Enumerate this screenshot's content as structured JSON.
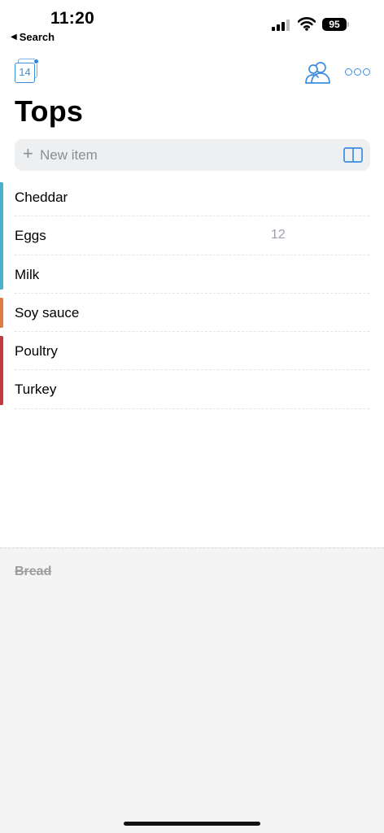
{
  "status_bar": {
    "time": "11:20",
    "back_label": "Search",
    "battery": "95"
  },
  "toolbar": {
    "calendar_day": "14",
    "accent_color": "#3b8de0"
  },
  "list": {
    "title": "Tops",
    "new_item_placeholder": "New item",
    "items": [
      {
        "label": "Cheddar",
        "qty": "",
        "color": "#4bb0cc"
      },
      {
        "label": "Eggs",
        "qty": "12",
        "color": "#4bb0cc"
      },
      {
        "label": "Milk",
        "qty": "",
        "color": "#4bb0cc"
      },
      {
        "label": "Soy sauce",
        "qty": "",
        "color": "#e07b45"
      },
      {
        "label": "Poultry",
        "qty": "",
        "color": "#c0393f"
      },
      {
        "label": "Turkey",
        "qty": "",
        "color": "#c0393f"
      }
    ]
  },
  "completed": {
    "items": [
      {
        "label": "Bread"
      }
    ]
  }
}
